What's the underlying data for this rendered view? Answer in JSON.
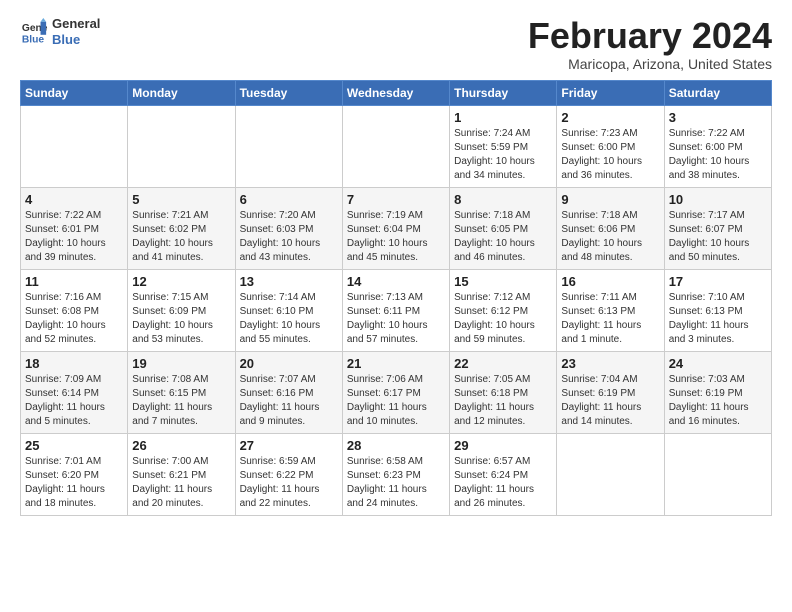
{
  "header": {
    "logo_general": "General",
    "logo_blue": "Blue",
    "month_title": "February 2024",
    "subtitle": "Maricopa, Arizona, United States"
  },
  "weekdays": [
    "Sunday",
    "Monday",
    "Tuesday",
    "Wednesday",
    "Thursday",
    "Friday",
    "Saturday"
  ],
  "weeks": [
    [
      {
        "day": "",
        "data": ""
      },
      {
        "day": "",
        "data": ""
      },
      {
        "day": "",
        "data": ""
      },
      {
        "day": "",
        "data": ""
      },
      {
        "day": "1",
        "data": "Sunrise: 7:24 AM\nSunset: 5:59 PM\nDaylight: 10 hours\nand 34 minutes."
      },
      {
        "day": "2",
        "data": "Sunrise: 7:23 AM\nSunset: 6:00 PM\nDaylight: 10 hours\nand 36 minutes."
      },
      {
        "day": "3",
        "data": "Sunrise: 7:22 AM\nSunset: 6:00 PM\nDaylight: 10 hours\nand 38 minutes."
      }
    ],
    [
      {
        "day": "4",
        "data": "Sunrise: 7:22 AM\nSunset: 6:01 PM\nDaylight: 10 hours\nand 39 minutes."
      },
      {
        "day": "5",
        "data": "Sunrise: 7:21 AM\nSunset: 6:02 PM\nDaylight: 10 hours\nand 41 minutes."
      },
      {
        "day": "6",
        "data": "Sunrise: 7:20 AM\nSunset: 6:03 PM\nDaylight: 10 hours\nand 43 minutes."
      },
      {
        "day": "7",
        "data": "Sunrise: 7:19 AM\nSunset: 6:04 PM\nDaylight: 10 hours\nand 45 minutes."
      },
      {
        "day": "8",
        "data": "Sunrise: 7:18 AM\nSunset: 6:05 PM\nDaylight: 10 hours\nand 46 minutes."
      },
      {
        "day": "9",
        "data": "Sunrise: 7:18 AM\nSunset: 6:06 PM\nDaylight: 10 hours\nand 48 minutes."
      },
      {
        "day": "10",
        "data": "Sunrise: 7:17 AM\nSunset: 6:07 PM\nDaylight: 10 hours\nand 50 minutes."
      }
    ],
    [
      {
        "day": "11",
        "data": "Sunrise: 7:16 AM\nSunset: 6:08 PM\nDaylight: 10 hours\nand 52 minutes."
      },
      {
        "day": "12",
        "data": "Sunrise: 7:15 AM\nSunset: 6:09 PM\nDaylight: 10 hours\nand 53 minutes."
      },
      {
        "day": "13",
        "data": "Sunrise: 7:14 AM\nSunset: 6:10 PM\nDaylight: 10 hours\nand 55 minutes."
      },
      {
        "day": "14",
        "data": "Sunrise: 7:13 AM\nSunset: 6:11 PM\nDaylight: 10 hours\nand 57 minutes."
      },
      {
        "day": "15",
        "data": "Sunrise: 7:12 AM\nSunset: 6:12 PM\nDaylight: 10 hours\nand 59 minutes."
      },
      {
        "day": "16",
        "data": "Sunrise: 7:11 AM\nSunset: 6:13 PM\nDaylight: 11 hours\nand 1 minute."
      },
      {
        "day": "17",
        "data": "Sunrise: 7:10 AM\nSunset: 6:13 PM\nDaylight: 11 hours\nand 3 minutes."
      }
    ],
    [
      {
        "day": "18",
        "data": "Sunrise: 7:09 AM\nSunset: 6:14 PM\nDaylight: 11 hours\nand 5 minutes."
      },
      {
        "day": "19",
        "data": "Sunrise: 7:08 AM\nSunset: 6:15 PM\nDaylight: 11 hours\nand 7 minutes."
      },
      {
        "day": "20",
        "data": "Sunrise: 7:07 AM\nSunset: 6:16 PM\nDaylight: 11 hours\nand 9 minutes."
      },
      {
        "day": "21",
        "data": "Sunrise: 7:06 AM\nSunset: 6:17 PM\nDaylight: 11 hours\nand 10 minutes."
      },
      {
        "day": "22",
        "data": "Sunrise: 7:05 AM\nSunset: 6:18 PM\nDaylight: 11 hours\nand 12 minutes."
      },
      {
        "day": "23",
        "data": "Sunrise: 7:04 AM\nSunset: 6:19 PM\nDaylight: 11 hours\nand 14 minutes."
      },
      {
        "day": "24",
        "data": "Sunrise: 7:03 AM\nSunset: 6:19 PM\nDaylight: 11 hours\nand 16 minutes."
      }
    ],
    [
      {
        "day": "25",
        "data": "Sunrise: 7:01 AM\nSunset: 6:20 PM\nDaylight: 11 hours\nand 18 minutes."
      },
      {
        "day": "26",
        "data": "Sunrise: 7:00 AM\nSunset: 6:21 PM\nDaylight: 11 hours\nand 20 minutes."
      },
      {
        "day": "27",
        "data": "Sunrise: 6:59 AM\nSunset: 6:22 PM\nDaylight: 11 hours\nand 22 minutes."
      },
      {
        "day": "28",
        "data": "Sunrise: 6:58 AM\nSunset: 6:23 PM\nDaylight: 11 hours\nand 24 minutes."
      },
      {
        "day": "29",
        "data": "Sunrise: 6:57 AM\nSunset: 6:24 PM\nDaylight: 11 hours\nand 26 minutes."
      },
      {
        "day": "",
        "data": ""
      },
      {
        "day": "",
        "data": ""
      }
    ]
  ]
}
